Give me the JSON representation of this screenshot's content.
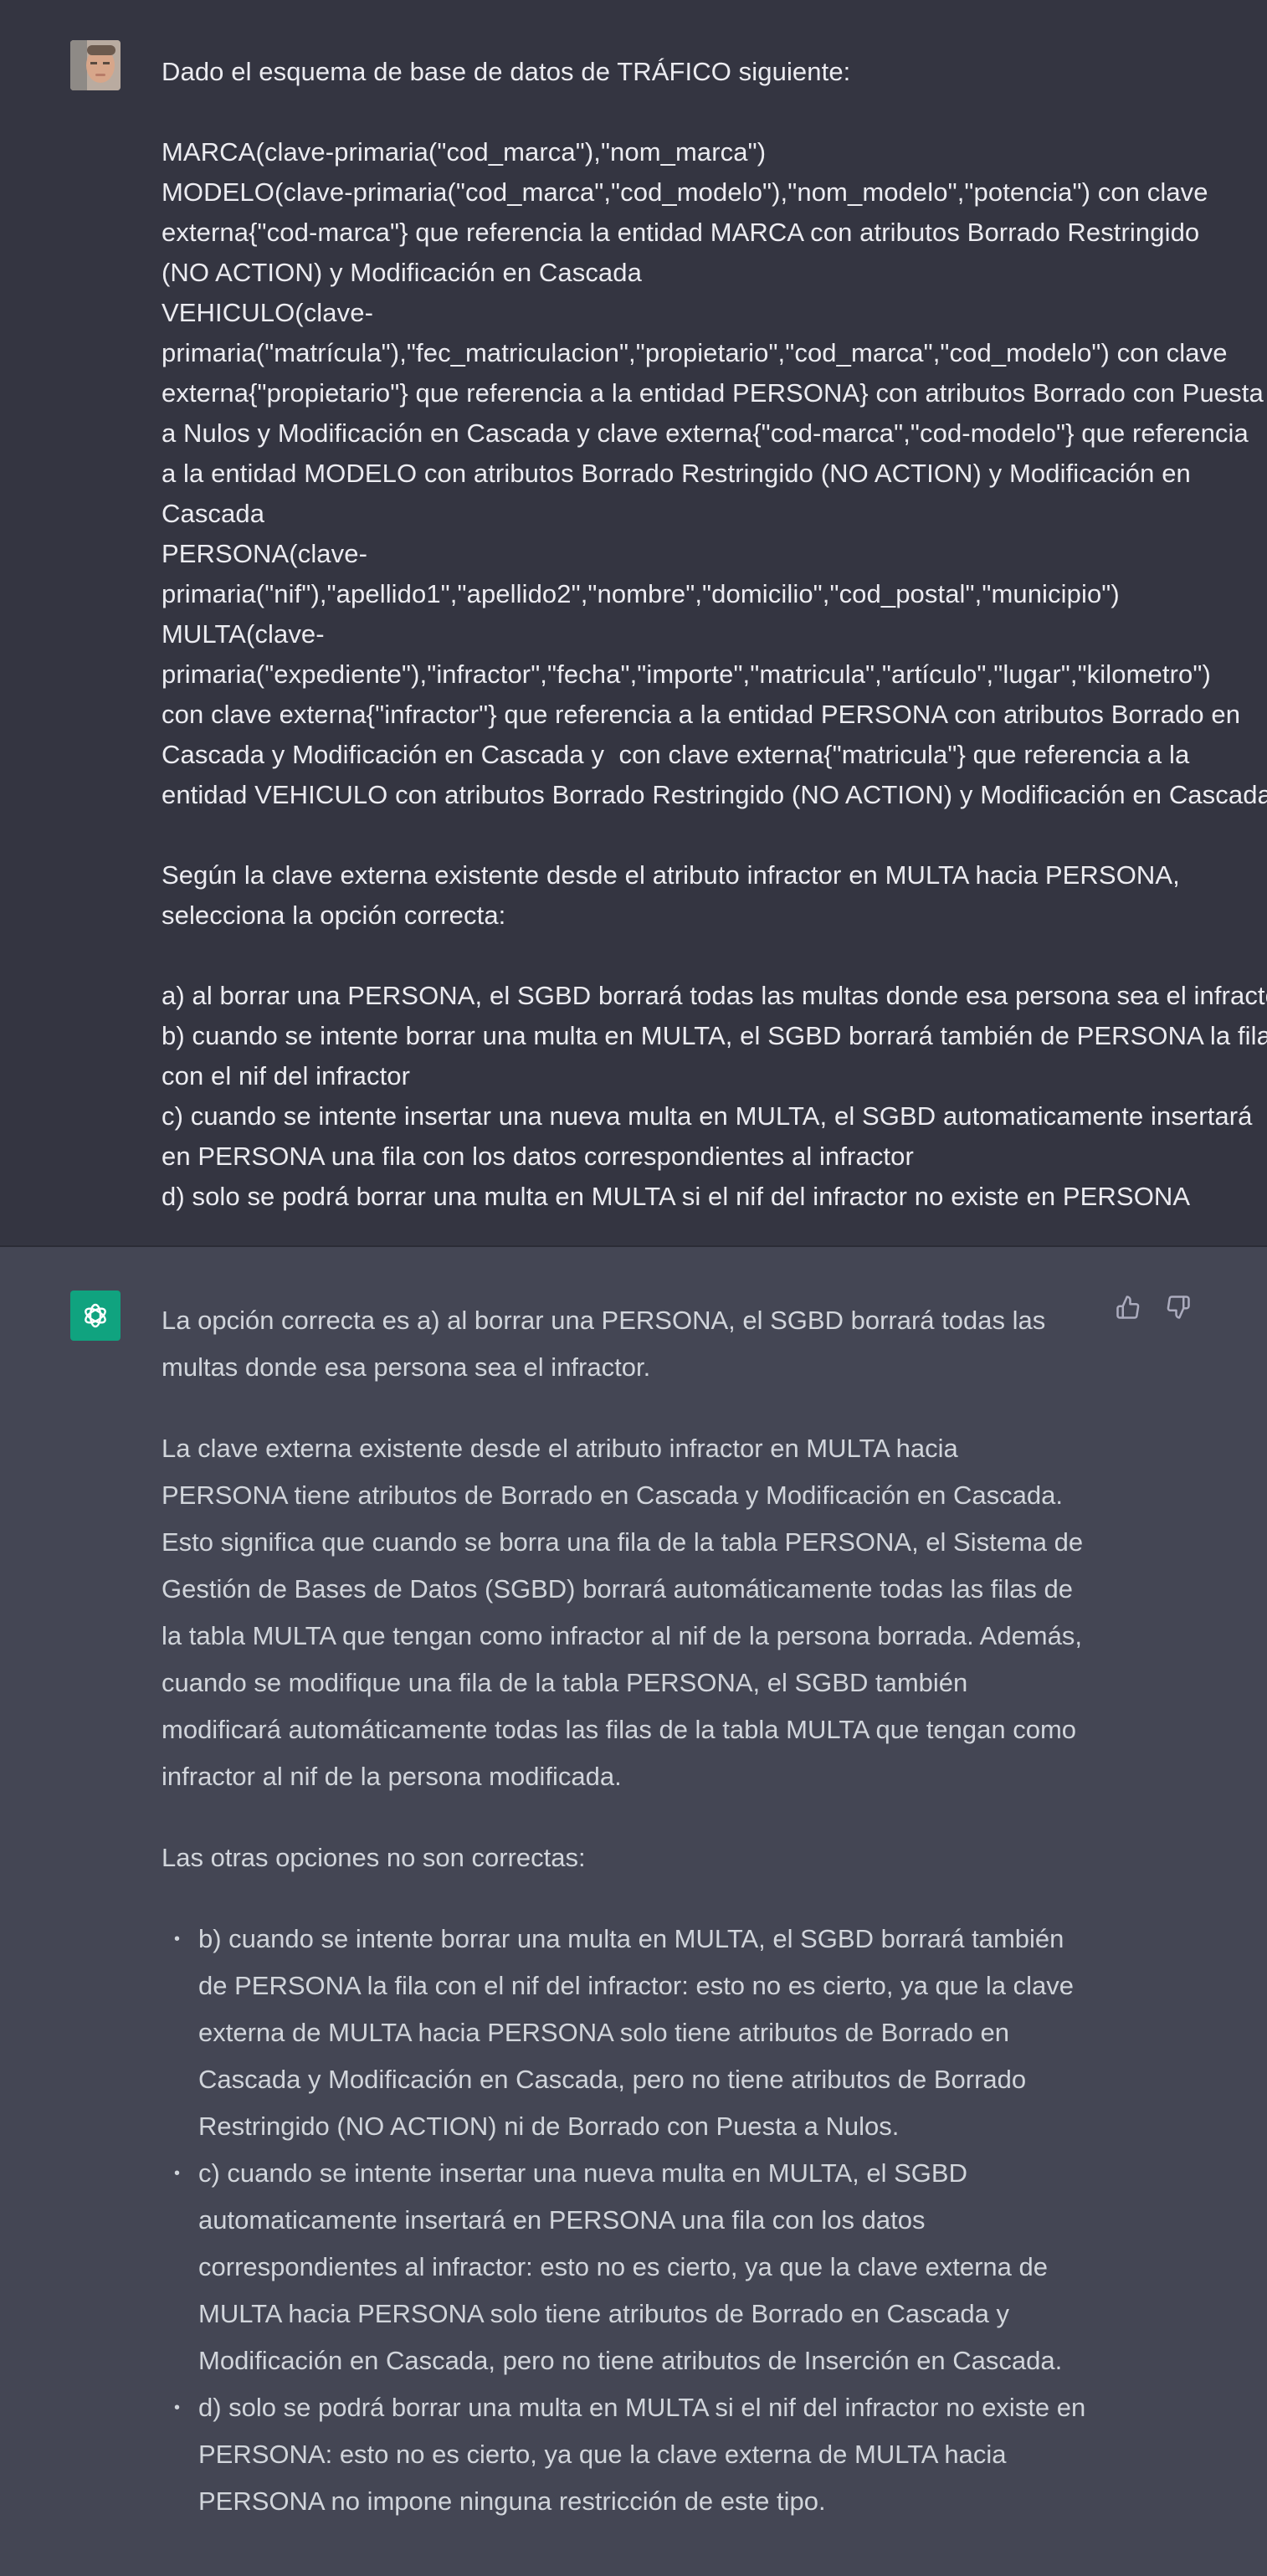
{
  "user_message": {
    "avatar": "user-avatar",
    "lines": [
      "Dado el esquema de base de datos de TRÁFICO siguiente:",
      "",
      "MARCA(clave-primaria(\"cod_marca\"),\"nom_marca\")",
      "MODELO(clave-primaria(\"cod_marca\",\"cod_modelo\"),\"nom_modelo\",\"potencia\") con clave",
      "externa{\"cod-marca\"} que referencia la entidad MARCA con atributos Borrado Restringido",
      "(NO ACTION) y Modificación en Cascada",
      "VEHICULO(clave-",
      "primaria(\"matrícula\"),\"fec_matriculacion\",\"propietario\",\"cod_marca\",\"cod_modelo\") con clave",
      "externa{\"propietario\"} que referencia a la entidad PERSONA} con atributos Borrado con Puesta",
      "a Nulos y Modificación en Cascada y clave externa{\"cod-marca\",\"cod-modelo\"} que referencia",
      "a la entidad MODELO con atributos Borrado Restringido (NO ACTION) y Modificación en",
      "Cascada",
      "PERSONA(clave-",
      "primaria(\"nif\"),\"apellido1\",\"apellido2\",\"nombre\",\"domicilio\",\"cod_postal\",\"municipio\")",
      "MULTA(clave-",
      "primaria(\"expediente\"),\"infractor\",\"fecha\",\"importe\",\"matricula\",\"artículo\",\"lugar\",\"kilometro\")",
      "con clave externa{\"infractor\"} que referencia a la entidad PERSONA con atributos Borrado en",
      "Cascada y Modificación en Cascada y  con clave externa{\"matricula\"} que referencia a la",
      "entidad VEHICULO con atributos Borrado Restringido (NO ACTION) y Modificación en Cascada",
      "",
      "Según la clave externa existente desde el atributo infractor en MULTA hacia PERSONA,",
      "selecciona la opción correcta:",
      "",
      "a) al borrar una PERSONA, el SGBD borrará todas las multas donde esa persona sea el infractor",
      "b) cuando se intente borrar una multa en MULTA, el SGBD borrará también de PERSONA la fila",
      "con el nif del infractor",
      "c) cuando se intente insertar una nueva multa en MULTA, el SGBD automaticamente insertará",
      "en PERSONA una fila con los datos correspondientes al infractor",
      "d) solo se podrá borrar una multa en MULTA si el nif del infractor no existe en PERSONA"
    ]
  },
  "assistant_message": {
    "avatar": "assistant-logo-icon",
    "paragraphs": [
      "La opción correcta es a) al borrar una PERSONA, el SGBD borrará todas las multas donde esa persona sea el infractor.",
      "La clave externa existente desde el atributo infractor en MULTA hacia PERSONA tiene atributos de Borrado en Cascada y Modificación en Cascada. Esto significa que cuando se borra una fila de la tabla PERSONA, el Sistema de Gestión de Bases de Datos (SGBD) borrará automáticamente todas las filas de la tabla MULTA que tengan como infractor al nif de la persona borrada. Además, cuando se modifique una fila de la tabla PERSONA, el SGBD también modificará automáticamente todas las filas de la tabla MULTA que tengan como infractor al nif de la persona modificada.",
      "Las otras opciones no son correctas:"
    ],
    "bullets": [
      "b) cuando se intente borrar una multa en MULTA, el SGBD borrará también de PERSONA la fila con el nif del infractor: esto no es cierto, ya que la clave externa de MULTA hacia PERSONA solo tiene atributos de Borrado en Cascada y Modificación en Cascada, pero no tiene atributos de Borrado Restringido (NO ACTION) ni de Borrado con Puesta a Nulos.",
      "c) cuando se intente insertar una nueva multa en MULTA, el SGBD automaticamente insertará en PERSONA una fila con los datos correspondientes al infractor: esto no es cierto, ya que la clave externa de MULTA hacia PERSONA solo tiene atributos de Borrado en Cascada y Modificación en Cascada, pero no tiene atributos de Inserción en Cascada.",
      "d) solo se podrá borrar una multa en MULTA si el nif del infractor no existe en PERSONA: esto no es cierto, ya que la clave externa de MULTA hacia PERSONA no impone ninguna restricción de este tipo."
    ],
    "bullet_glyph": "•",
    "feedback": {
      "thumbs_up": "thumbs-up-icon",
      "thumbs_down": "thumbs-down-icon"
    }
  },
  "colors": {
    "user_bg": "#343541",
    "assistant_bg": "#444654",
    "user_text": "#ececf1",
    "assistant_text": "#d1d5db",
    "brand_green": "#10a37f"
  }
}
